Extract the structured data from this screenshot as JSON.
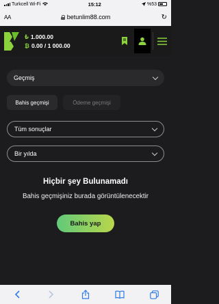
{
  "status": {
    "carrier": "Turkcell Wi-Fi",
    "time": "15:12",
    "battery": "%53"
  },
  "browser": {
    "aa": "AA",
    "url": "betunlim88.com"
  },
  "header": {
    "balance_currency_symbol": "₺",
    "bonus_currency_symbol": "₿",
    "balance": "1.000.00",
    "bonus": "0.00 / 1 000.00"
  },
  "filters": {
    "history_select": "Geçmiş",
    "tabs": [
      {
        "label": "Bahis geçmişi"
      },
      {
        "label": "Ödeme geçmişi"
      }
    ],
    "results_select": "Tüm sonuçlar",
    "period_select": "Bir yılda"
  },
  "empty_state": {
    "title": "Hiçbir şey Bulunamadı",
    "description": "Bahis geçmişiniz burada görüntülenecektir",
    "button": "Bahis yap"
  },
  "colors": {
    "accent": "#8bd23c",
    "button_gradient_start": "#62c97a",
    "button_gradient_end": "#b8d64a",
    "safari_blue": "#2f7ae5"
  }
}
